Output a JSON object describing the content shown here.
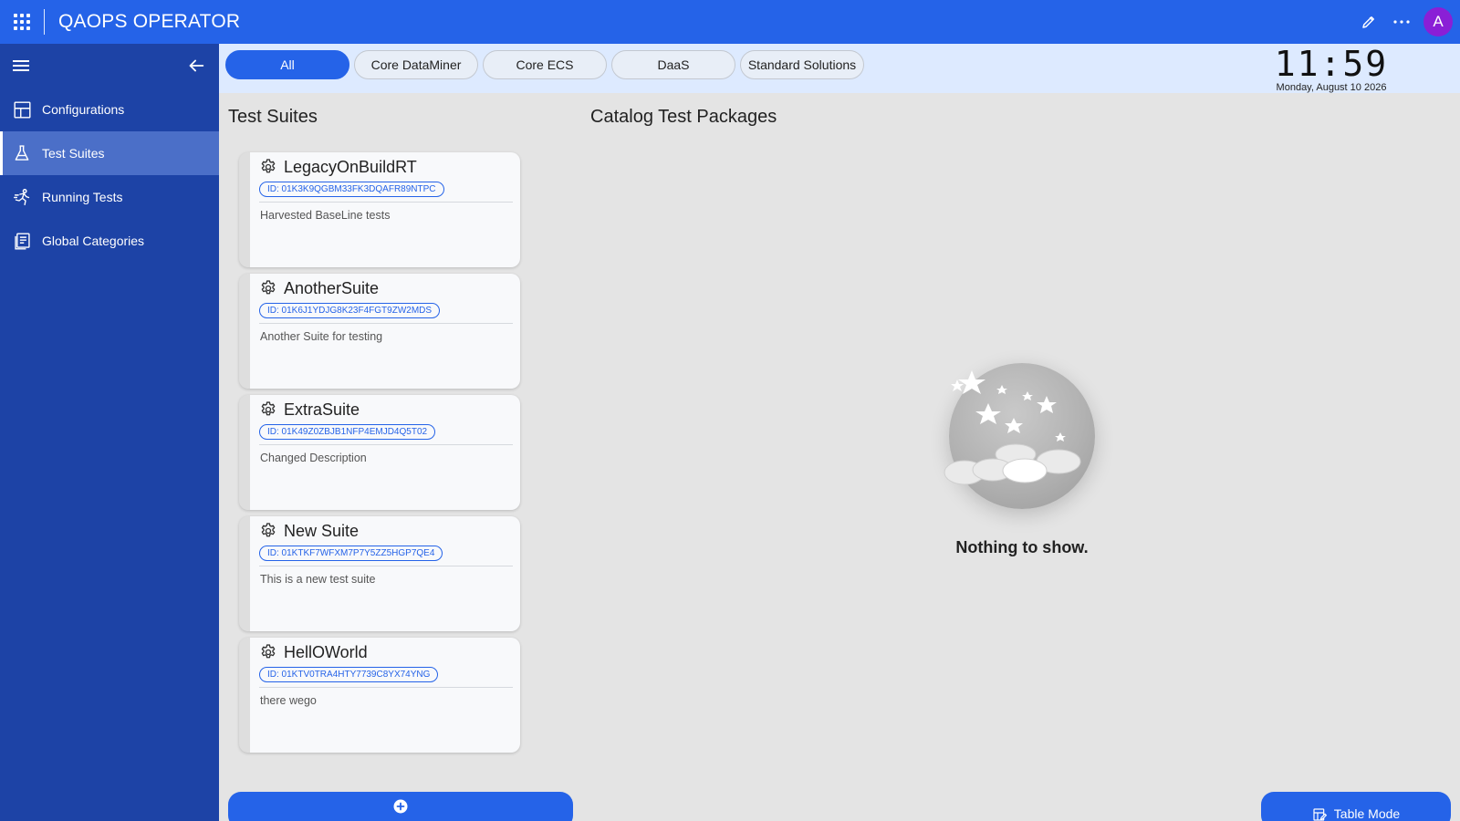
{
  "app": {
    "title": "QAOPS OPERATOR",
    "avatar_letter": "A"
  },
  "sidebar": {
    "items": [
      {
        "label": "Configurations",
        "icon": "layout-icon"
      },
      {
        "label": "Test Suites",
        "icon": "flask-icon",
        "active": true
      },
      {
        "label": "Running Tests",
        "icon": "runner-icon"
      },
      {
        "label": "Global Categories",
        "icon": "document-icon"
      }
    ]
  },
  "filters": {
    "chips": [
      "All",
      "Core DataMiner",
      "Core ECS",
      "DaaS",
      "Standard Solutions"
    ],
    "selected": "All"
  },
  "clock": {
    "time": "11:59",
    "date": "Monday, August 10 2026"
  },
  "sections": {
    "test_suites": "Test Suites",
    "catalog": "Catalog Test Packages"
  },
  "suites": [
    {
      "name": "LegacyOnBuildRT",
      "id": "ID: 01K3K9QGBM33FK3DQAFR89NTPC",
      "description": "Harvested BaseLine tests"
    },
    {
      "name": "AnotherSuite",
      "id": "ID: 01K6J1YDJG8K23F4FGT9ZW2MDS",
      "description": "Another Suite for testing"
    },
    {
      "name": "ExtraSuite",
      "id": "ID: 01K49Z0ZBJB1NFP4EMJD4Q5T02",
      "description": "Changed Description"
    },
    {
      "name": "New Suite",
      "id": "ID: 01KTKF7WFXM7P7Y5ZZ5HGP7QE4",
      "description": "This is a new test suite"
    },
    {
      "name": "HellOWorld",
      "id": "ID: 01KTV0TRA4HTY7739C8YX74YNG",
      "description": "there wego"
    }
  ],
  "empty_state": {
    "text": "Nothing to show."
  },
  "buttons": {
    "table_mode": "Table Mode"
  },
  "colors": {
    "primary": "#2563e8",
    "sidebar": "#1d43a6",
    "sidebar_active": "#4b6fc8",
    "avatar": "#8a1fd6"
  }
}
